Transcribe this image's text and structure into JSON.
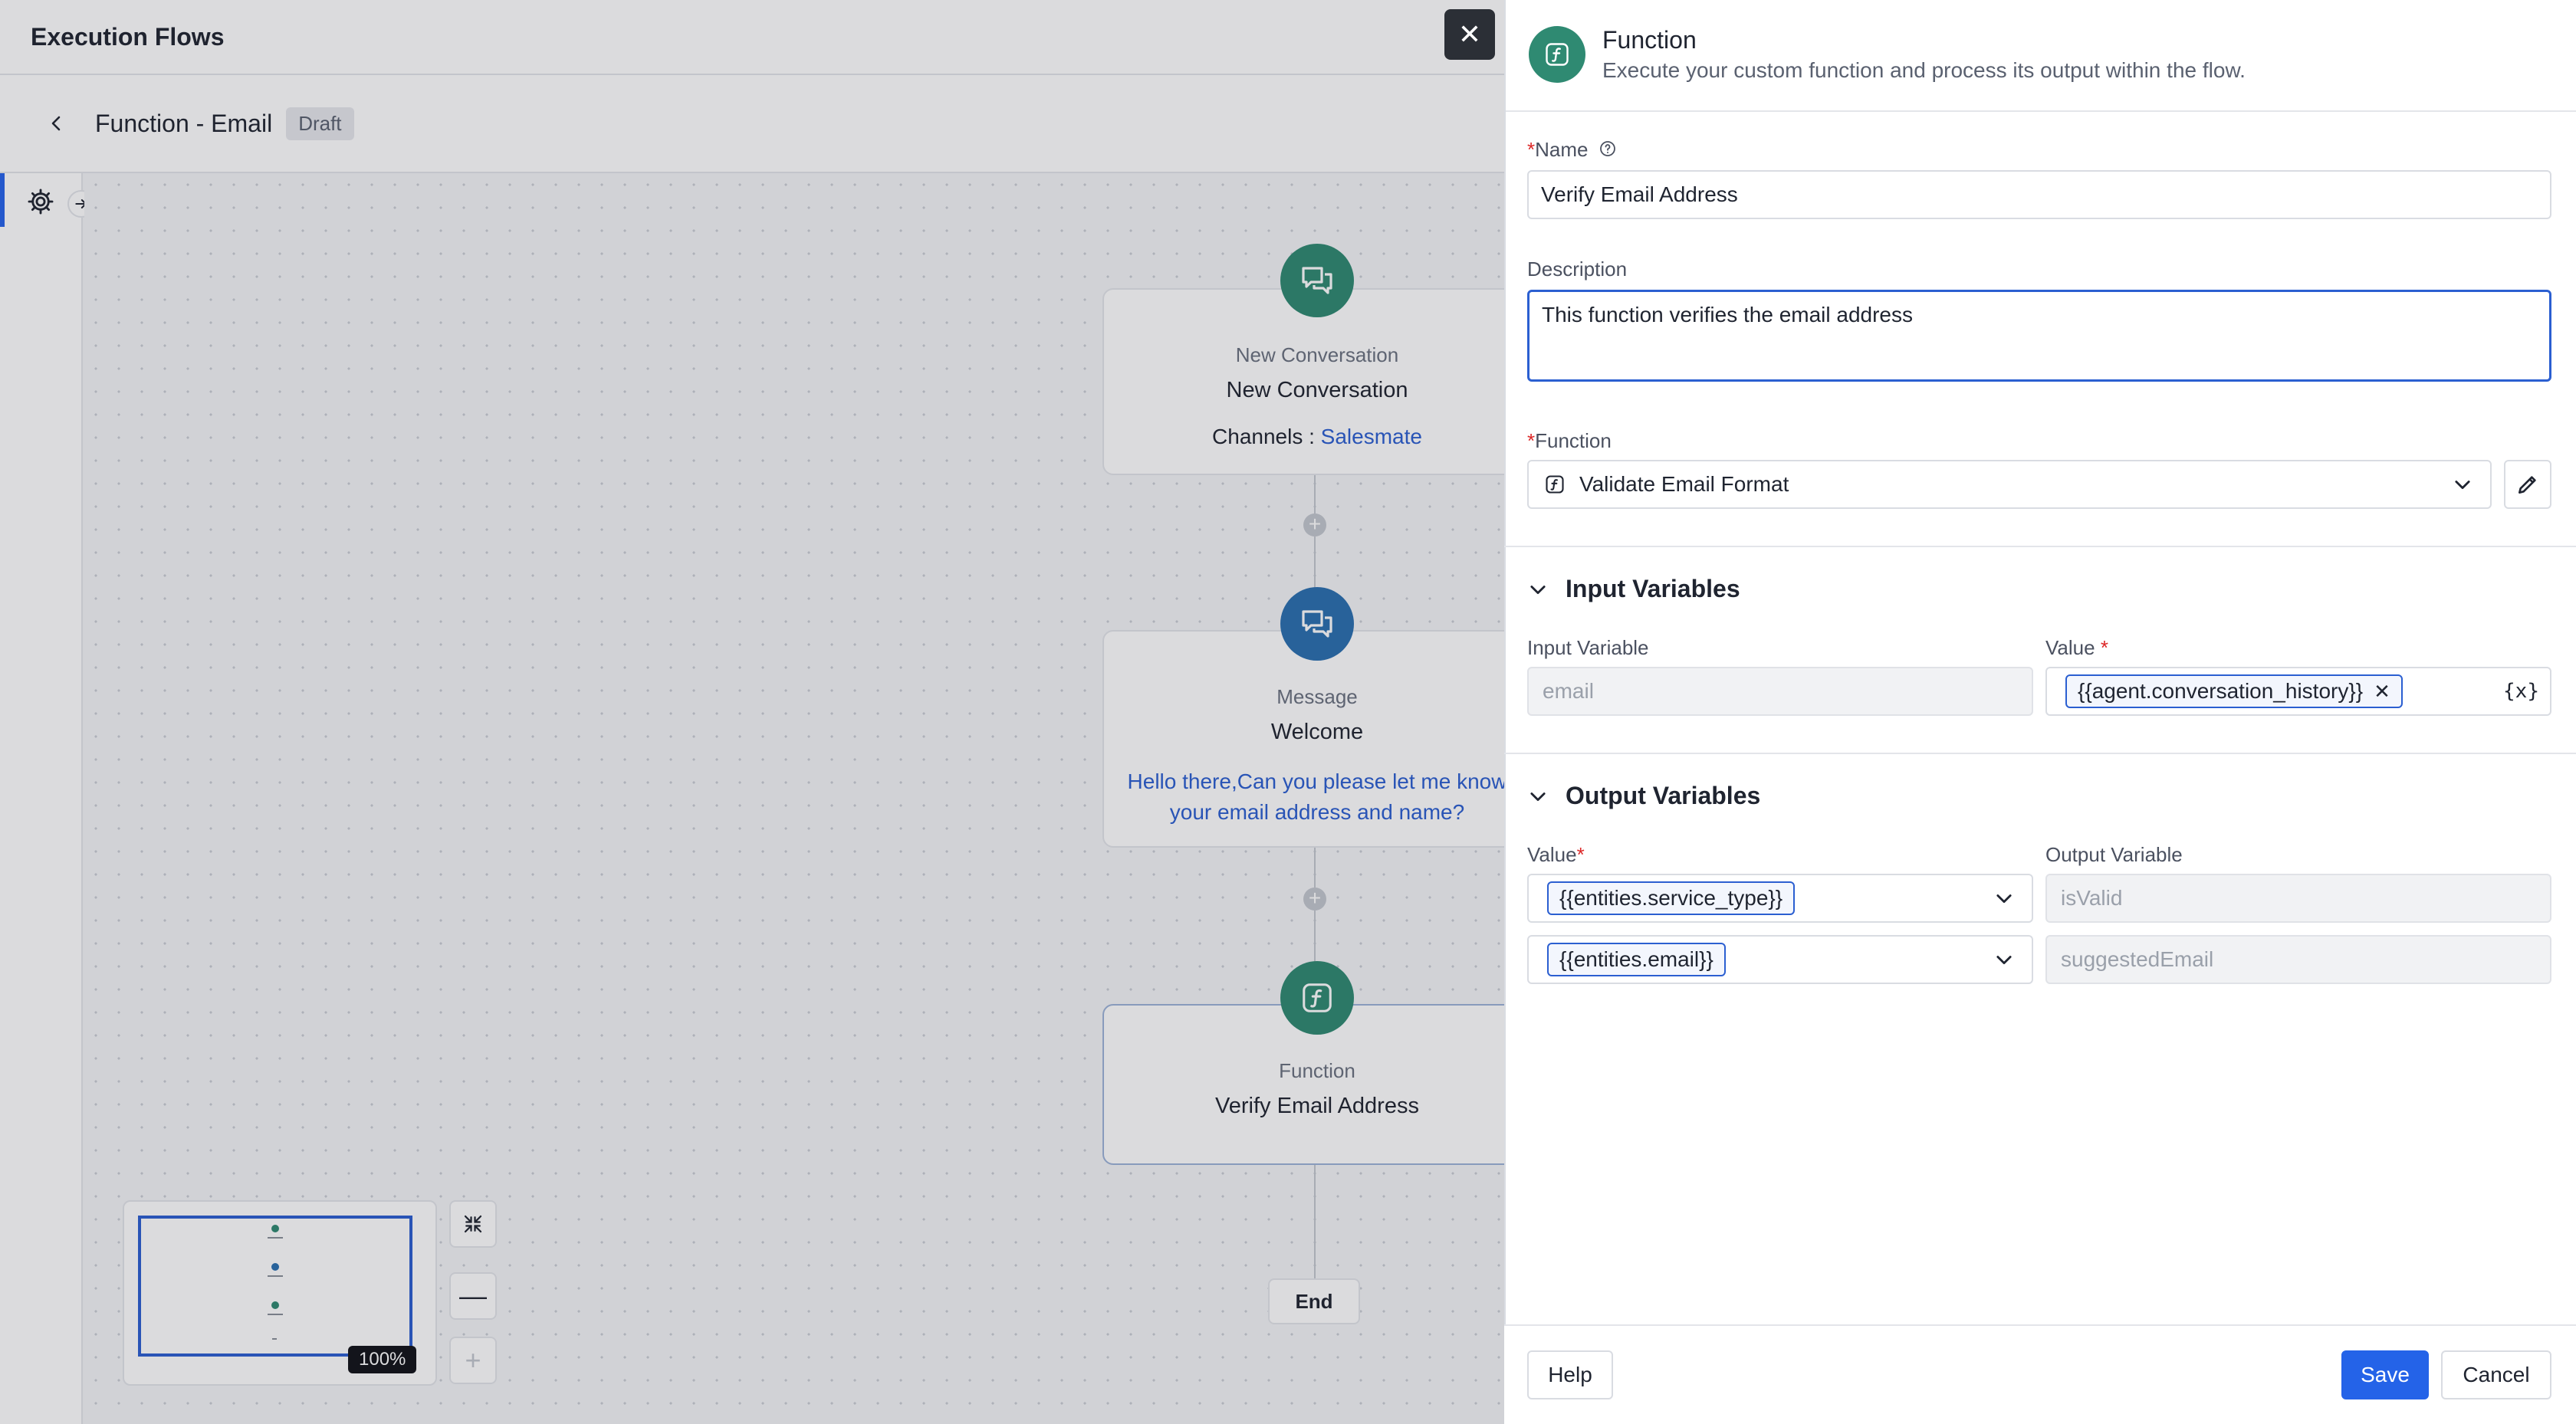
{
  "app": {
    "title": "Execution Flows",
    "flow_name": "Function - Email",
    "status_badge": "Draft"
  },
  "canvas": {
    "nodes": [
      {
        "type": "New Conversation",
        "title": "New Conversation",
        "detail_label": "Channels : ",
        "detail_value": "Salesmate",
        "icon": "chat-bubbles-icon",
        "color": "#2f8a72"
      },
      {
        "type": "Message",
        "title": "Welcome",
        "message": "Hello there,Can you please let me know your email address and name?",
        "icon": "message-bubbles-icon",
        "color": "#2a6fb0"
      },
      {
        "type": "Function",
        "title": "Verify Email Address",
        "icon": "function-icon",
        "color": "#2f8a72"
      }
    ],
    "end_label": "End",
    "zoom_level": "100%"
  },
  "drawer": {
    "title": "Function",
    "subtitle": "Execute your custom function and process its output within the flow.",
    "name_label": "Name",
    "name_value": "Verify Email Address",
    "description_label": "Description",
    "description_value": "This function verifies the email address",
    "function_label": "Function",
    "function_value": "Validate Email Format",
    "input_section": {
      "title": "Input Variables",
      "col_input": "Input Variable",
      "col_value": "Value",
      "rows": [
        {
          "input": "email",
          "value": "{{agent.conversation_history}}"
        }
      ]
    },
    "output_section": {
      "title": "Output Variables",
      "col_value": "Value",
      "col_output": "Output Variable",
      "rows": [
        {
          "value": "{{entities.service_type}}",
          "output": "isValid"
        },
        {
          "value": "{{entities.email}}",
          "output": "suggestedEmail"
        }
      ]
    },
    "footer": {
      "help": "Help",
      "save": "Save",
      "cancel": "Cancel"
    }
  }
}
